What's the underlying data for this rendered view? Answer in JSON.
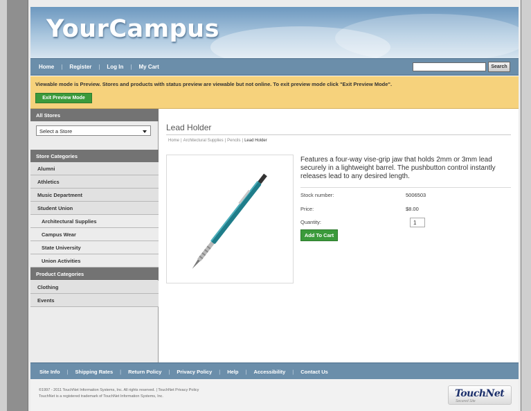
{
  "banner": {
    "logo": "YourCampus"
  },
  "topnav": {
    "items": [
      "Home",
      "Register",
      "Log In",
      "My Cart"
    ],
    "separator": "|",
    "search_button": "Search",
    "search_value": ""
  },
  "preview": {
    "message": "Viewable mode is Preview. Stores and products with status preview are viewable but not online. To exit preview mode click \"Exit Preview Mode\".",
    "exit_button": "Exit Preview Mode"
  },
  "sidebar": {
    "all_stores_header": "All Stores",
    "store_select": "Select a Store",
    "store_categories_header": "Store Categories",
    "store_categories": [
      "Alumni",
      "Athletics",
      "Music Department",
      "Student Union"
    ],
    "sub_categories": [
      "Architectural Supplies",
      "Campus Wear",
      "State University",
      "Union Activities"
    ],
    "product_categories_header": "Product Categories",
    "product_categories": [
      "Clothing",
      "Events"
    ]
  },
  "product": {
    "title": "Lead Holder",
    "breadcrumb": [
      "Home",
      "Architectural Supplies",
      "Pencils",
      "Lead Holder"
    ],
    "description": "Features a four-way vise-grip jaw that holds 2mm or 3mm lead securely in a lightweight barrel. The pushbutton control instantly releases lead to any desired length.",
    "stock_label": "Stock number:",
    "stock_value": "5006503",
    "price_label": "Price:",
    "price_value": "$8.00",
    "quantity_label": "Quantity:",
    "quantity_value": "1",
    "add_to_cart": "Add To Cart"
  },
  "footer": {
    "items": [
      "Site Info",
      "Shipping Rates",
      "Return Policy",
      "Privacy Policy",
      "Help",
      "Accessibility",
      "Contact Us"
    ],
    "copyright_line1": "©1997 - 2011 TouchNet Information Systems, Inc. All rights reserved. | TouchNet Privacy Policy",
    "copyright_line2": "TouchNet is a registered trademark of TouchNet Information Systems, Inc.",
    "logo_brand": "TouchNet",
    "logo_tag": "Secured Site"
  },
  "colors": {
    "nav_blue": "#6b8eaa",
    "preview_yellow": "#f6d27c",
    "button_green": "#3b9a3b",
    "sidebar_header": "#737373"
  }
}
